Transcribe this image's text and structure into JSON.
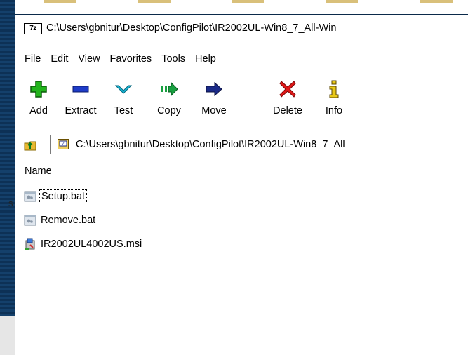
{
  "window": {
    "title": "C:\\Users\\gbnitur\\Desktop\\ConfigPilot\\IR2002UL-Win8_7_All-Win",
    "app_icon_text": "7z"
  },
  "menu": [
    "File",
    "Edit",
    "View",
    "Favorites",
    "Tools",
    "Help"
  ],
  "toolbar": [
    {
      "label": "Add",
      "icon": "plus-icon"
    },
    {
      "label": "Extract",
      "icon": "minus-icon"
    },
    {
      "label": "Test",
      "icon": "check-icon"
    },
    {
      "label": "Copy",
      "icon": "copy-arrow-icon"
    },
    {
      "label": "Move",
      "icon": "move-arrow-icon"
    },
    {
      "label": "Delete",
      "icon": "x-icon"
    },
    {
      "label": "Info",
      "icon": "info-icon"
    }
  ],
  "address": {
    "path": "C:\\Users\\gbnitur\\Desktop\\ConfigPilot\\IR2002UL-Win8_7_All"
  },
  "file_list": {
    "column_header": "Name",
    "files": [
      {
        "name": "Setup.bat",
        "icon": "batch-file-icon"
      },
      {
        "name": "Remove.bat",
        "icon": "batch-file-icon"
      },
      {
        "name": "IR2002UL4002US.msi",
        "icon": "installer-icon"
      }
    ]
  },
  "desktop": {
    "edge_char": "s"
  },
  "colors": {
    "add_green": "#22b31c",
    "extract_blue": "#1e3cc8",
    "test_cyan": "#18b8d8",
    "move_navy": "#1a2a88",
    "delete_red": "#e01818",
    "info_gold": "#8a6a00"
  }
}
